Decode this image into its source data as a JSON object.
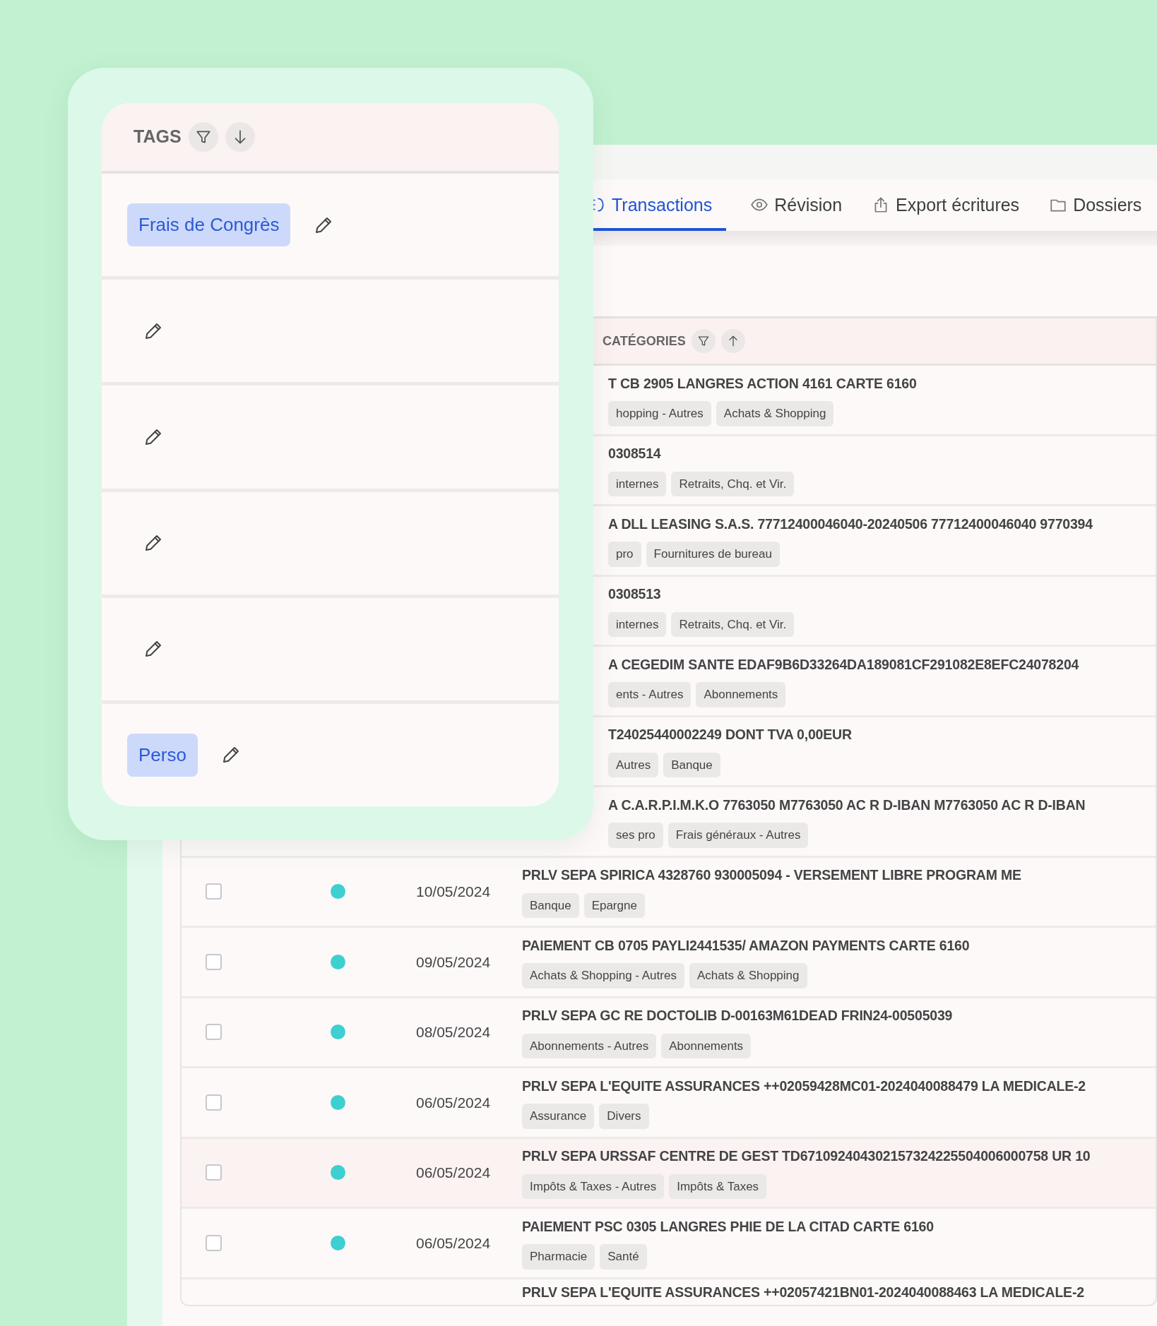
{
  "tags_panel": {
    "header": "TAGS",
    "rows": [
      {
        "tag": "Frais de Congrès"
      },
      {},
      {},
      {},
      {},
      {
        "tag": "Perso"
      }
    ]
  },
  "tabs": [
    {
      "label": "Transactions",
      "selected": true
    },
    {
      "label": "Révision",
      "selected": false
    },
    {
      "label": "Export écritures",
      "selected": false
    },
    {
      "label": "Dossiers",
      "selected": false
    }
  ],
  "table": {
    "header": "CATÉGORIES",
    "rows": [
      {
        "kind": "partial",
        "title": "T CB 2905 LANGRES ACTION 4161 CARTE 6160",
        "categories": [
          "hopping - Autres",
          "Achats & Shopping"
        ]
      },
      {
        "kind": "partial",
        "title": "0308514",
        "categories": [
          "internes",
          "Retraits, Chq. et Vir."
        ]
      },
      {
        "kind": "partial",
        "title": "A DLL LEASING S.A.S. 77712400046040-20240506 77712400046040 9770394",
        "categories": [
          "pro",
          "Fournitures de bureau"
        ]
      },
      {
        "kind": "partial",
        "title": "0308513",
        "categories": [
          "internes",
          "Retraits, Chq. et Vir."
        ]
      },
      {
        "kind": "partial",
        "title": "A CEGEDIM SANTE EDAF9B6D33264DA189081CF291082E8EFC24078204",
        "categories": [
          "ents - Autres",
          "Abonnements"
        ]
      },
      {
        "kind": "partial",
        "title": "T24025440002249 DONT TVA 0,00EUR",
        "categories": [
          "Autres",
          "Banque"
        ]
      },
      {
        "kind": "partial",
        "title": "A C.A.R.P.I.M.K.O 7763050 M7763050 AC R D-IBAN M7763050 AC R D-IBAN",
        "categories": [
          "ses pro",
          "Frais généraux - Autres"
        ]
      },
      {
        "kind": "full",
        "checked": false,
        "color": "#3ecfd0",
        "date": "10/05/2024",
        "title": "PRLV SEPA SPIRICA 4328760 930005094 - VERSEMENT LIBRE PROGRAM ME",
        "categories": [
          "Banque",
          "Epargne"
        ],
        "highlighted": false
      },
      {
        "kind": "full",
        "checked": false,
        "color": "#3ecfd0",
        "date": "09/05/2024",
        "title": "PAIEMENT CB 0705 PAYLI2441535/ AMAZON PAYMENTS CARTE 6160",
        "categories": [
          "Achats & Shopping - Autres",
          "Achats & Shopping"
        ],
        "highlighted": false
      },
      {
        "kind": "full",
        "checked": false,
        "color": "#3ecfd0",
        "date": "08/05/2024",
        "title": "PRLV SEPA GC RE DOCTOLIB D-00163M61DEAD FRIN24-00505039",
        "categories": [
          "Abonnements - Autres",
          "Abonnements"
        ],
        "highlighted": false
      },
      {
        "kind": "full",
        "checked": false,
        "color": "#3ecfd0",
        "date": "06/05/2024",
        "title": "PRLV SEPA L'EQUITE ASSURANCES ++02059428MC01-2024040088479 LA MEDICALE-2",
        "categories": [
          "Assurance",
          "Divers"
        ],
        "highlighted": false
      },
      {
        "kind": "full",
        "checked": false,
        "color": "#3ecfd0",
        "date": "06/05/2024",
        "title": "PRLV SEPA URSSAF CENTRE DE GEST TD671092404302157324225504006000758 UR 10",
        "categories": [
          "Impôts & Taxes - Autres",
          "Impôts & Taxes"
        ],
        "highlighted": true
      },
      {
        "kind": "full",
        "checked": false,
        "color": "#3ecfd0",
        "date": "06/05/2024",
        "title": "PAIEMENT PSC 0305 LANGRES PHIE DE LA CITAD CARTE 6160",
        "categories": [
          "Pharmacie",
          "Santé"
        ],
        "highlighted": false
      },
      {
        "kind": "cut",
        "title": "PRLV SEPA L'EQUITE ASSURANCES ++02057421BN01-2024040088463 LA MEDICALE-2"
      }
    ]
  }
}
